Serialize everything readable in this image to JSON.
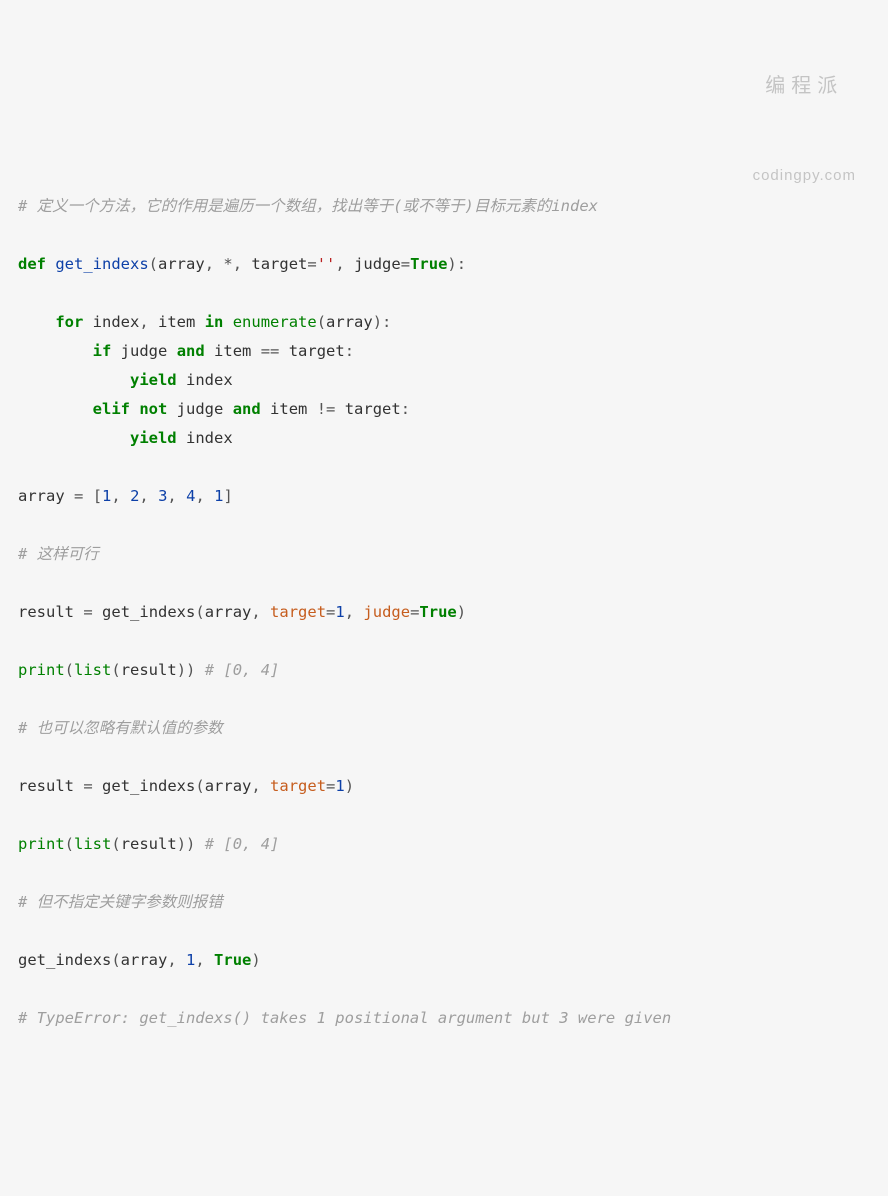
{
  "watermark": {
    "cn": "编程派",
    "en": "codingpy.com"
  },
  "code": {
    "c1": "# 定义一个方法，它的作用是遍历一个数组，找出等于(或不等于)目标元素的index",
    "kw_def": "def",
    "fn_name": "get_indexs",
    "p_array": "array",
    "star": "*",
    "p_target": "target",
    "empty_str": "''",
    "p_judge": "judge",
    "true": "True",
    "kw_for": "for",
    "v_index": "index",
    "v_item": "item",
    "kw_in": "in",
    "fn_enum": "enumerate",
    "kw_if": "if",
    "kw_and": "and",
    "op_eq": "==",
    "kw_yield": "yield",
    "kw_elif": "elif",
    "kw_not": "not",
    "op_neq": "!=",
    "v_array": "array",
    "n1": "1",
    "n2": "2",
    "n3": "3",
    "n4": "4",
    "c2": "# 这样可行",
    "v_result": "result",
    "fn_print": "print",
    "fn_list": "list",
    "c_out1": "# [0, 4]",
    "c3": "# 也可以忽略有默认值的参数",
    "c_out2": "# [0, 4]",
    "c4": "# 但不指定关键字参数则报错",
    "c5": "# TypeError: get_indexs() takes 1 positional argument but 3 were given"
  }
}
